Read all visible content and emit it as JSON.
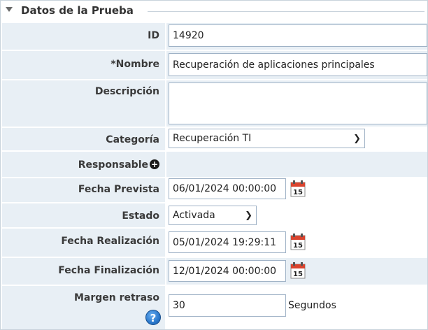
{
  "section": {
    "title": "Datos de la Prueba"
  },
  "fields": {
    "id": {
      "label": "ID",
      "value": "14920"
    },
    "nombre": {
      "label": "*Nombre",
      "value": "Recuperación de aplicaciones principales"
    },
    "descripcion": {
      "label": "Descripción",
      "value": ""
    },
    "categoria": {
      "label": "Categoría",
      "selected": "Recuperación TI"
    },
    "responsable": {
      "label": "Responsable",
      "add_icon": "plus-circle-icon"
    },
    "fecha_prevista": {
      "label": "Fecha Prevista",
      "value": "06/01/2024 00:00:00"
    },
    "estado": {
      "label": "Estado",
      "selected": "Activada"
    },
    "fecha_realizacion": {
      "label": "Fecha Realización",
      "value": "05/01/2024 19:29:11"
    },
    "fecha_finalizacion": {
      "label": "Fecha Finalización",
      "value": "12/01/2024 00:00:00"
    },
    "margen_retraso": {
      "label": "Margen retraso",
      "value": "30",
      "units": "Segundos",
      "help_icon": "help-icon"
    }
  },
  "calendar_icon": {
    "name": "calendar-icon",
    "day": "15"
  },
  "colors": {
    "label_bg": "#e8eff5",
    "input_border": "#9fb2c6",
    "help_blue": "#2a78cc",
    "calendar_red": "#d9442f"
  }
}
